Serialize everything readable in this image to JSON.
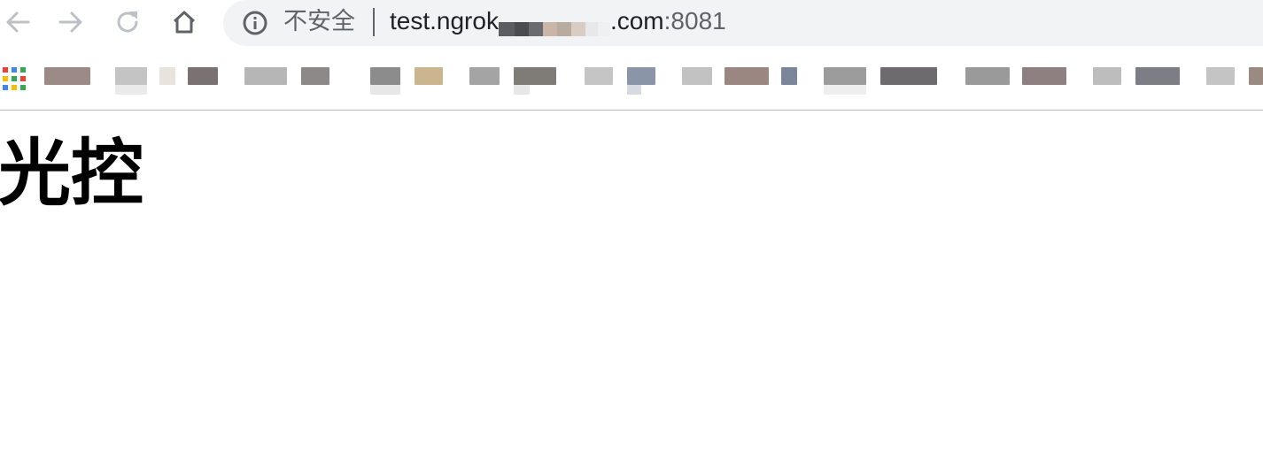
{
  "browser": {
    "security_label": "不安全",
    "url_host_prefix": "test.ngrok",
    "url_host_suffix": ".com",
    "url_port": ":8081",
    "icons": {
      "back": "arrow-left-icon",
      "forward": "arrow-right-icon",
      "reload": "reload-icon",
      "home": "home-icon",
      "info": "info-circle-icon",
      "apps": "apps-grid-icon"
    },
    "colors": {
      "toolbar": "#ffffff",
      "omnibox": "#f1f3f4",
      "icon_disabled": "#bdc1c6",
      "icon_active": "#5f6368",
      "url_text": "#202124"
    }
  },
  "bookmarks": {
    "apps_colors": [
      "#ea4335",
      "#4285f4",
      "#34a853",
      "#fbbc05"
    ]
  },
  "page": {
    "title": "光控"
  }
}
